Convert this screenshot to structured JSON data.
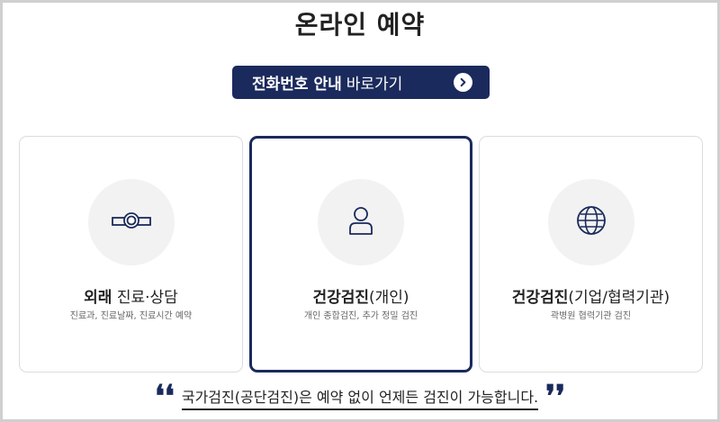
{
  "page": {
    "title": "온라인 예약"
  },
  "phone_button": {
    "bold_label": "전화번호 안내",
    "light_label": "바로가기",
    "icon": "chevron-right-icon"
  },
  "cards": [
    {
      "title_strong": "외래",
      "title_sub": " 진료·상담",
      "description": "진료과, 진료날짜, 진료시간 예약",
      "icon": "stethoscope-icon",
      "selected": false
    },
    {
      "title_strong": "건강검진",
      "title_sub": "(개인)",
      "description": "개인 종합검진, 추가 정밀 검진",
      "icon": "person-icon",
      "selected": true
    },
    {
      "title_strong": "건강검진",
      "title_sub": "(기업/협력기관)",
      "description": "곽병원 협력기관 검진",
      "icon": "globe-icon",
      "selected": false
    }
  ],
  "notice": {
    "open_quote": "❛❛",
    "text": "국가검진(공단검진)은 예약 없이 언제든 검진이 가능합니다.",
    "close_quote": "❜❜"
  },
  "colors": {
    "navy": "#1b2a5c",
    "card_border": "#dcdcdc",
    "icon_bg": "#f2f2f2"
  }
}
